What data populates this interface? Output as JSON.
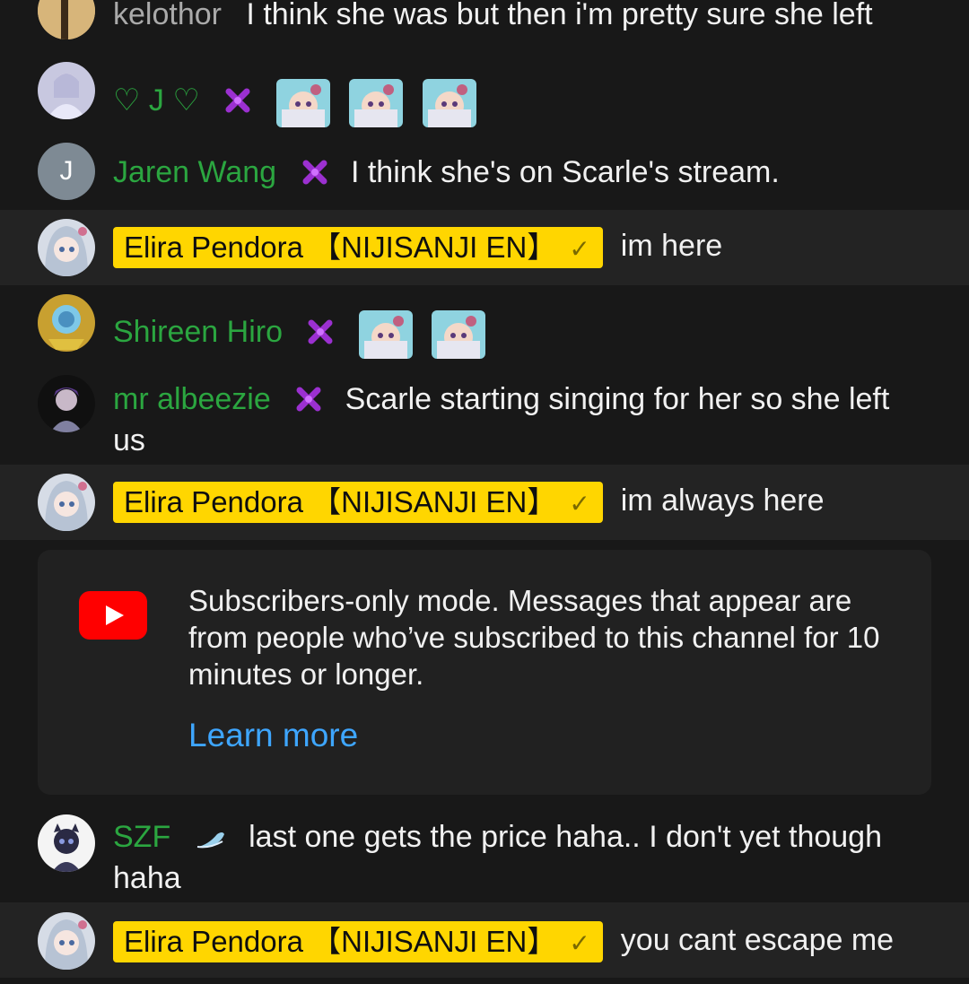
{
  "messages": [
    {
      "author": "kelothor",
      "text": "I think she was but then i'm pretty sure she left"
    },
    {
      "author": "♡ J ♡",
      "emotes": [
        "fish-girl-emote",
        "fish-girl-emote",
        "fish-girl-emote"
      ]
    },
    {
      "author": "Jaren Wang",
      "avatar_letter": "J",
      "text": "I think she's on Scarle's stream."
    },
    {
      "author": "Elira Pendora 【NIJISANJI EN】",
      "text": "im here"
    },
    {
      "author": "Shireen Hiro",
      "emotes": [
        "fish-girl-emote",
        "fish-girl-emote"
      ]
    },
    {
      "author": "mr albeezie",
      "text": "Scarle starting singing for her so she left us"
    },
    {
      "author": "Elira Pendora 【NIJISANJI EN】",
      "text": "im always here"
    },
    {
      "author": "SZF",
      "text": "last one gets the price haha.. I don't yet though haha"
    },
    {
      "author": "Elira Pendora 【NIJISANJI EN】",
      "text": "you cant escape me"
    }
  ],
  "notice": {
    "text": "Subscribers-only mode. Messages that appear are from people who’ve subscribed to this channel for 10 minutes or longer.",
    "link": "Learn more"
  },
  "colors": {
    "background": "#181818",
    "owner_row": "#232323",
    "member_name": "#2ba640",
    "owner_chip": "#ffd600",
    "link": "#3ea6ff",
    "youtube_red": "#ff0000",
    "member_badge": "#9b30d0"
  },
  "icons": {
    "member_badge": "member-badge-icon",
    "verified": "check-icon",
    "youtube": "youtube-logo-icon",
    "szf_badge": "wing-badge-icon"
  }
}
